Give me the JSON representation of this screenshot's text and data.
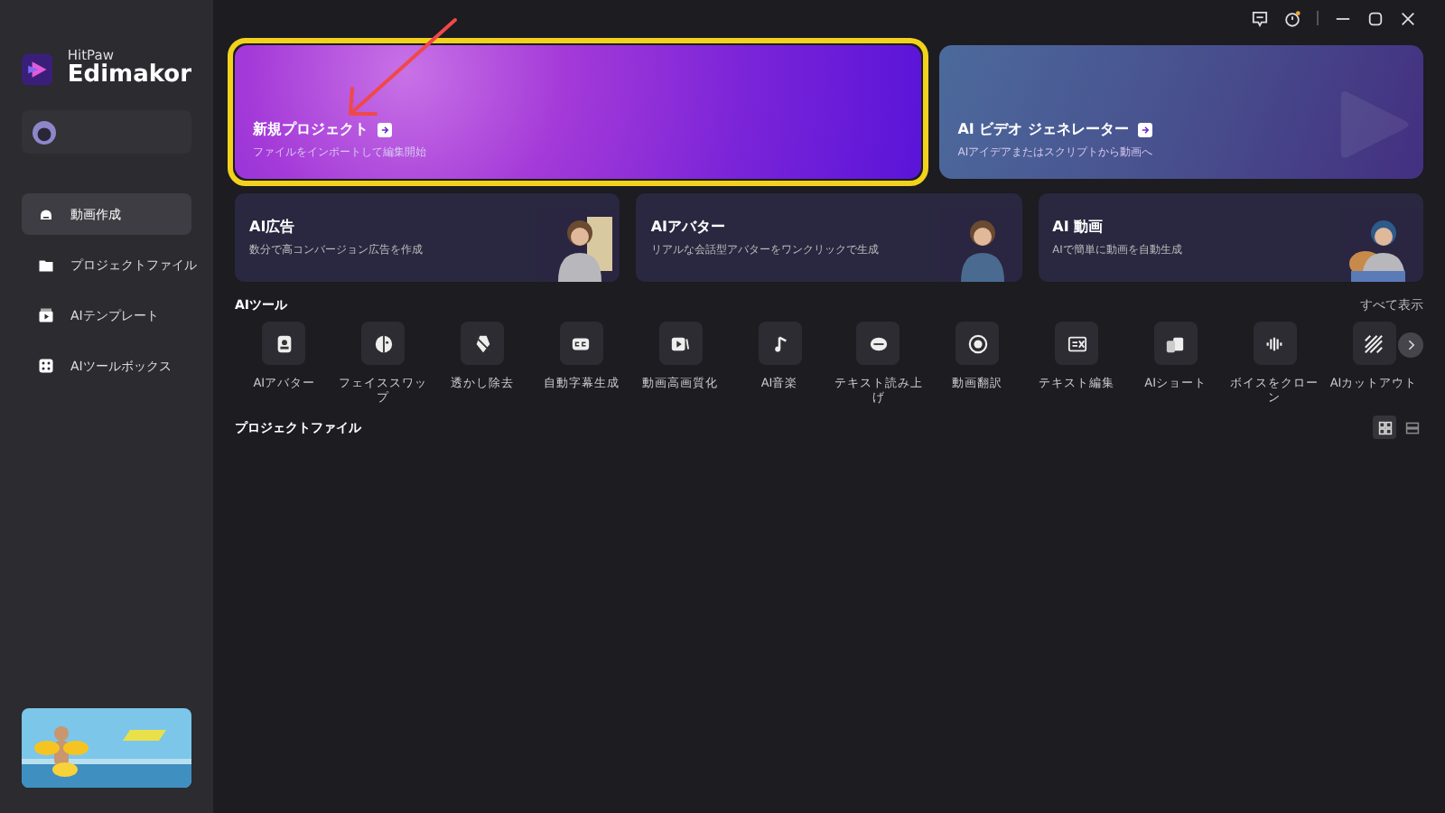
{
  "sidebar": {
    "brand": {
      "company": "HitPaw",
      "product": "Edimakor"
    },
    "items": [
      {
        "label": "動画作成",
        "selected": true
      },
      {
        "label": "プロジェクトファイル",
        "selected": false
      },
      {
        "label": "AIテンプレート",
        "selected": false
      },
      {
        "label": "AIツールボックス",
        "selected": false
      }
    ]
  },
  "hero_cards": [
    {
      "title": "新規プロジェクト",
      "subtitle": "ファイルをインポートして編集開始",
      "highlighted": true
    },
    {
      "title": "AI ビデオ ジェネレーター",
      "subtitle": "AIアイデアまたはスクリプトから動画へ",
      "highlighted": false
    }
  ],
  "feature_cards": [
    {
      "title": "AI広告",
      "subtitle": "数分で高コンバージョン広告を作成"
    },
    {
      "title": "AIアバター",
      "subtitle": "リアルな会話型アバターをワンクリックで生成"
    },
    {
      "title": "AI 動画",
      "subtitle": "AIで簡単に動画を自動生成"
    }
  ],
  "tools_section": {
    "title": "AIツール",
    "show_all": "すべて表示",
    "tools": [
      {
        "label": "AIアバター"
      },
      {
        "label": "フェイススワップ"
      },
      {
        "label": "透かし除去"
      },
      {
        "label": "自動字幕生成"
      },
      {
        "label": "動画高画質化"
      },
      {
        "label": "AI音楽"
      },
      {
        "label": "テキスト読み上げ"
      },
      {
        "label": "動画翻訳"
      },
      {
        "label": "テキスト編集"
      },
      {
        "label": "AIショート"
      },
      {
        "label": "ボイスをクローン"
      },
      {
        "label": "AIカットアウト"
      }
    ]
  },
  "projects_section": {
    "title": "プロジェクトファイル",
    "views": [
      {
        "kind": "grid",
        "selected": true
      },
      {
        "kind": "list",
        "selected": false
      }
    ]
  }
}
